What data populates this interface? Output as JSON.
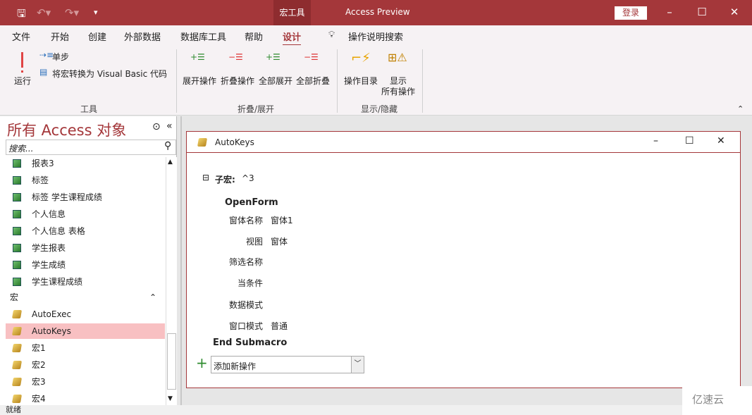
{
  "titlebar": {
    "context_tab": "宏工具",
    "app_title": "Access Preview",
    "login": "登录",
    "save_icon": "save-icon",
    "undo_icon": "undo-icon",
    "redo_icon": "redo-icon",
    "customize_icon": "customize-qat-icon"
  },
  "tabs": [
    "文件",
    "开始",
    "创建",
    "外部数据",
    "数据库工具",
    "帮助",
    "设计"
  ],
  "active_tab": "设计",
  "tell_me": "操作说明搜索",
  "ribbon": {
    "tools": {
      "run": "运行",
      "single_step": "单步",
      "convert": "将宏转换为 Visual Basic 代码",
      "label": "工具"
    },
    "collapse_expand": {
      "expand": "展开操作",
      "collapse": "折叠操作",
      "expand_all": "全部展开",
      "collapse_all": "全部折叠",
      "label": "折叠/展开"
    },
    "show_hide": {
      "catalog": "操作目录",
      "show_all_1": "显示",
      "show_all_2": "所有操作",
      "label": "显示/隐藏"
    }
  },
  "nav": {
    "title": "所有 Access 对象",
    "search_placeholder": "搜索...",
    "reports": [
      "报表3",
      "标签",
      "标签 学生课程成绩",
      "个人信息",
      "个人信息 表格",
      "学生报表",
      "学生成绩",
      "学生课程成绩"
    ],
    "macro_group": "宏",
    "macros": [
      "AutoExec",
      "AutoKeys",
      "宏1",
      "宏2",
      "宏3",
      "宏4"
    ],
    "selected": "AutoKeys"
  },
  "macro_window": {
    "title": "AutoKeys",
    "submacro_label": "子宏:",
    "submacro_name": "^3",
    "action": "OpenForm",
    "args": [
      {
        "name": "窗体名称",
        "value": "窗体1"
      },
      {
        "name": "视图",
        "value": "窗体"
      },
      {
        "name": "筛选名称",
        "value": ""
      },
      {
        "name": "当条件",
        "value": ""
      },
      {
        "name": "数据模式",
        "value": ""
      },
      {
        "name": "窗口模式",
        "value": "普通"
      }
    ],
    "end": "End Submacro",
    "add_action": "添加新操作"
  },
  "status": "就绪",
  "watermark": "亿速云",
  "colors": {
    "accent": "#a4373a",
    "selected": "#f8c0c2"
  }
}
